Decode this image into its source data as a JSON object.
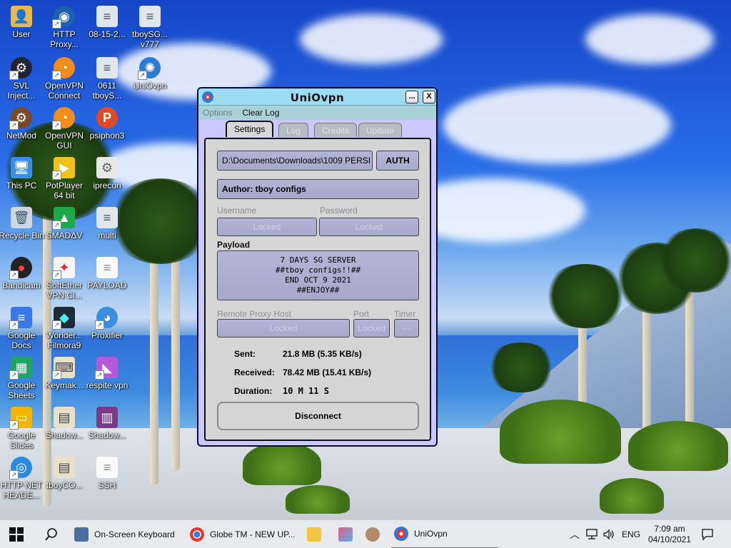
{
  "desktop": {
    "icons": [
      {
        "label": "User",
        "icon": "user-folder-icon"
      },
      {
        "label": "HTTP Proxy...",
        "icon": "http-proxy-icon"
      },
      {
        "label": "08-15-2...",
        "icon": "document-icon"
      },
      {
        "label": "tboySG... v777",
        "icon": "document-icon"
      },
      {
        "label": "SVL Inject...",
        "icon": "svl-icon"
      },
      {
        "label": "OpenVPN Connect",
        "icon": "openvpn-icon"
      },
      {
        "label": "0611 tboyS...",
        "icon": "document-icon"
      },
      {
        "label": "UniOvpn",
        "icon": "uniovpn-icon"
      },
      {
        "label": "NetMod",
        "icon": "netmod-icon"
      },
      {
        "label": "OpenVPN GUI",
        "icon": "openvpn-icon"
      },
      {
        "label": "psiphon3",
        "icon": "psiphon-icon"
      },
      {
        "label": "This PC",
        "icon": "computer-icon"
      },
      {
        "label": "PotPlayer 64 bit",
        "icon": "potplayer-icon"
      },
      {
        "label": "iprecon",
        "icon": "iprecon-icon"
      },
      {
        "label": "Recycle Bin",
        "icon": "recycle-bin-icon"
      },
      {
        "label": "SMADΔV",
        "icon": "smadav-icon"
      },
      {
        "label": "multi",
        "icon": "document-icon"
      },
      {
        "label": "Bandicam",
        "icon": "bandicam-icon"
      },
      {
        "label": "SoftEther VPN Cl...",
        "icon": "softether-icon"
      },
      {
        "label": "PAYLOAD",
        "icon": "text-file-icon"
      },
      {
        "label": "Google Docs",
        "icon": "google-docs-icon"
      },
      {
        "label": "Wonder... Filmora9",
        "icon": "filmora-icon"
      },
      {
        "label": "Proxifier",
        "icon": "proxifier-icon"
      },
      {
        "label": "Google Sheets",
        "icon": "google-sheets-icon"
      },
      {
        "label": "Keymak...",
        "icon": "keymaker-icon"
      },
      {
        "label": "respite vpn",
        "icon": "respite-vpn-icon"
      },
      {
        "label": "Google Slides",
        "icon": "google-slides-icon"
      },
      {
        "label": "Shadow...",
        "icon": "shadow-icon"
      },
      {
        "label": "Shadow...",
        "icon": "winrar-icon"
      },
      {
        "label": "HTTP NET HEADE...",
        "icon": "http-net-icon"
      },
      {
        "label": "tboyCO...",
        "icon": "document-icon"
      },
      {
        "label": "SSH",
        "icon": "text-file-icon"
      }
    ]
  },
  "window": {
    "title": "UniOvpn",
    "minimize_label": "...",
    "close_label": "X",
    "menu": {
      "options": "Options",
      "clear_log": "Clear Log"
    },
    "tabs": [
      {
        "label": "Settings",
        "active": true
      },
      {
        "label": "Log",
        "active": false
      },
      {
        "label": "Credits",
        "active": false
      },
      {
        "label": "Update",
        "active": false
      }
    ],
    "config_path": "D:\\Documents\\Downloads\\1009 PERSI",
    "auth_label": "AUTH",
    "author": "Author: tboy configs",
    "username_label": "Username",
    "password_label": "Password",
    "username_value": "Locked",
    "password_value": "Locked",
    "payload_label": "Payload",
    "payload_lines": [
      "7 DAYS SG SERVER",
      "##tboy configs!!##",
      "END OCT 9 2021",
      "##ENJOY##"
    ],
    "remote_proxy_label": "Remote Proxy Host",
    "port_label": "Port",
    "timer_label": "Timer",
    "remote_proxy_value": "Locked",
    "port_value": "Locked",
    "timer_value": "---",
    "sent_label": "Sent:",
    "sent_value": "21.8 MB (5.35 KB/s)",
    "received_label": "Received:",
    "received_value": "78.42 MB (15.41 KB/s)",
    "duration_label": "Duration:",
    "duration_value": "10 M 11 S",
    "disconnect_label": "Disconnect"
  },
  "taskbar": {
    "items": [
      {
        "label": "On-Screen Keyboard",
        "icon": "keyboard-icon"
      },
      {
        "label": "Globe TM - NEW UP...",
        "icon": "chrome-icon"
      },
      {
        "label": "",
        "icon": "file-explorer-icon"
      },
      {
        "label": "",
        "icon": "tool-icon"
      },
      {
        "label": "",
        "icon": "app-icon"
      },
      {
        "label": "UniOvpn",
        "icon": "uniovpn-icon"
      }
    ],
    "language": "ENG",
    "time": "7:09 am",
    "date": "04/10/2021"
  },
  "colors": {
    "window_bg": "#c9c9fb",
    "titlebar": "#9ddcf3",
    "field": "#aaacd0"
  }
}
